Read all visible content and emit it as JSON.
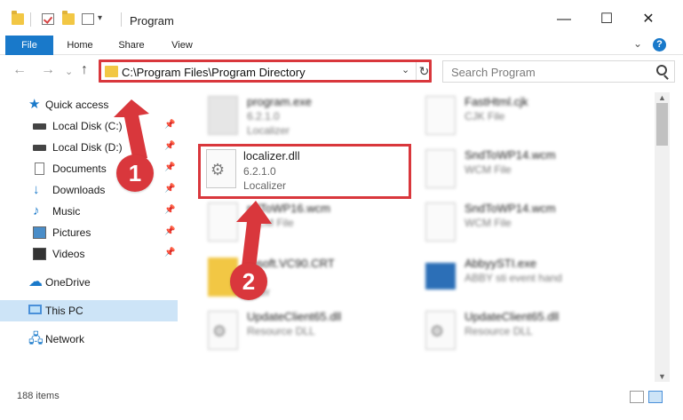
{
  "window": {
    "title": "Program",
    "minimize_glyph": "—",
    "maximize_glyph": "☐",
    "close_glyph": "✕"
  },
  "ribbon": {
    "tabs": [
      "File",
      "Home",
      "Share",
      "View"
    ],
    "help_glyph": "?",
    "collapse_glyph": "⌄"
  },
  "address": {
    "back_glyph": "←",
    "forward_glyph": "→",
    "recent_glyph": "⌄",
    "up_glyph": "↑",
    "path": "C:\\Program Files\\Program Directory",
    "dropdown_glyph": "⌄",
    "refresh_glyph": "↻"
  },
  "search": {
    "placeholder": "Search Program"
  },
  "sidebar": {
    "quick_access": "Quick access",
    "items": [
      {
        "label": "Local Disk (C:)",
        "icon": "disk-icon"
      },
      {
        "label": "Local Disk (D:)",
        "icon": "disk-icon"
      },
      {
        "label": "Documents",
        "icon": "documents-icon"
      },
      {
        "label": "Downloads",
        "icon": "downloads-icon"
      },
      {
        "label": "Music",
        "icon": "music-icon"
      },
      {
        "label": "Pictures",
        "icon": "pictures-icon"
      },
      {
        "label": "Videos",
        "icon": "videos-icon"
      }
    ],
    "onedrive": "OneDrive",
    "this_pc": "This PC",
    "network": "Network",
    "pin_glyph": "📌"
  },
  "files": {
    "focused": {
      "name": "localizer.dll",
      "version": "6.2.1.0",
      "company": "Localizer"
    },
    "left": [
      {
        "name": "program.exe",
        "line2": "6.2.1.0",
        "line3": "Localizer",
        "kind": "exe"
      },
      {
        "name": "ndToWP16.wcm",
        "line2": "WCM File",
        "line3": "",
        "kind": "blank"
      },
      {
        "name": "rosoft.VC90.CRT",
        "line2": "e",
        "line3": "lacer",
        "kind": "folder"
      },
      {
        "name": "UpdateClient65.dll",
        "line2": "Resource DLL",
        "line3": "",
        "kind": "dll"
      }
    ],
    "right": [
      {
        "name": "FastHtml.cjk",
        "line2": "CJK File",
        "line3": "",
        "kind": "blank"
      },
      {
        "name": "SndToWP14.wcm",
        "line2": "WCM File",
        "line3": "",
        "kind": "blank"
      },
      {
        "name": "SndToWP14.wcm",
        "line2": "WCM File",
        "line3": "",
        "kind": "blank"
      },
      {
        "name": "AbbyySTI.exe",
        "line2": "ABBY sti event hand",
        "line3": "",
        "kind": "app"
      },
      {
        "name": "UpdateClient65.dll",
        "line2": "Resource DLL",
        "line3": "",
        "kind": "dll"
      }
    ]
  },
  "status": {
    "item_count": "188 items"
  },
  "callouts": {
    "badge_1": "1",
    "badge_2": "2",
    "color": "#d9373c"
  },
  "colors": {
    "accent": "#1979ca",
    "highlight": "#d9373c",
    "selected_bg": "#cde4f7"
  }
}
